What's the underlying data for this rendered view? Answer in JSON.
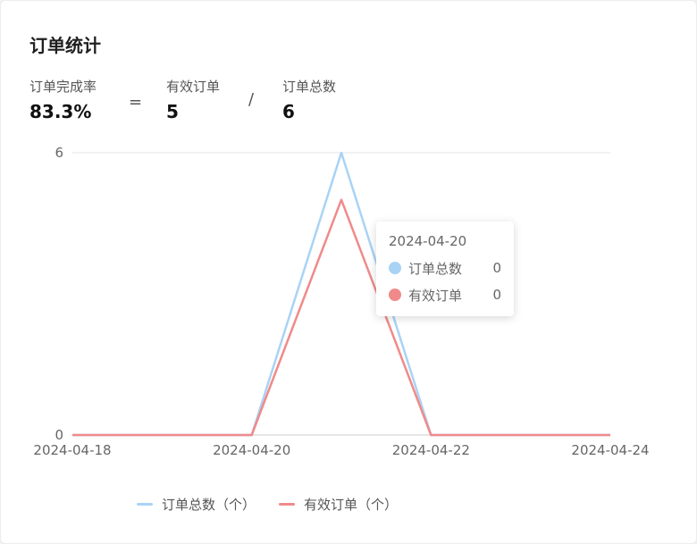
{
  "card": {
    "title": "订单统计"
  },
  "metrics": {
    "completion_rate": {
      "label": "订单完成率",
      "value": "83.3%"
    },
    "equals": "=",
    "valid_orders": {
      "label": "有效订单",
      "value": "5"
    },
    "divide": "/",
    "total_orders": {
      "label": "订单总数",
      "value": "6"
    }
  },
  "colors": {
    "total": "#a9d3f5",
    "valid": "#f08a8a"
  },
  "chart_data": {
    "type": "line",
    "x": [
      "2024-04-18",
      "2024-04-19",
      "2024-04-20",
      "2024-04-21",
      "2024-04-22",
      "2024-04-23",
      "2024-04-24"
    ],
    "series": [
      {
        "name": "订单总数（个）",
        "values": [
          0,
          0,
          0,
          6,
          0,
          0,
          0
        ]
      },
      {
        "name": "有效订单（个）",
        "values": [
          0,
          0,
          0,
          5,
          0,
          0,
          0
        ]
      }
    ],
    "x_tick_labels": [
      "2024-04-18",
      "2024-04-20",
      "2024-04-22",
      "2024-04-24"
    ],
    "y_tick_labels": [
      "0",
      "6"
    ],
    "ylim": [
      0,
      6
    ],
    "grid": true,
    "legend": "bottom-center"
  },
  "tooltip": {
    "date": "2024-04-20",
    "rows": [
      {
        "name": "订单总数",
        "value": "0"
      },
      {
        "name": "有效订单",
        "value": "0"
      }
    ]
  },
  "legend": {
    "items": [
      "订单总数（个）",
      "有效订单（个）"
    ]
  }
}
